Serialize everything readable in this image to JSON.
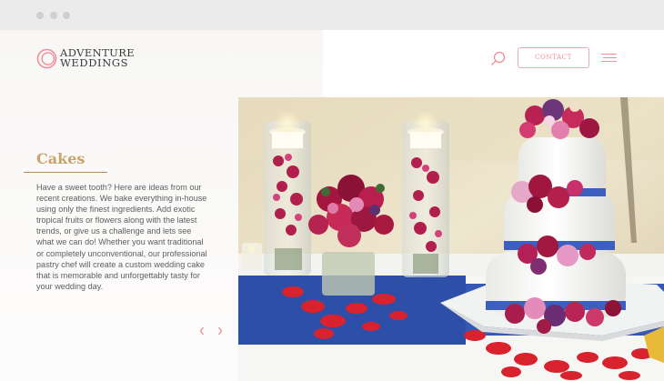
{
  "brand": {
    "name_line1": "ADVENTURE",
    "name_line2": "WEDDINGS",
    "accent_color": "#ef8e99",
    "gold_color": "#c9a46a"
  },
  "header": {
    "search_icon": "search-icon",
    "contact_label": "CONTACT",
    "menu_icon": "hamburger-menu-icon"
  },
  "section": {
    "title": "Cakes",
    "body": "Have a sweet tooth? Here are ideas from our recent creations. We bake everything in-house using only the finest ingredients. Add exotic tropical fruits or flowers along with the latest trends, or give us a challenge and lets see what we can do! Whether you want traditional or completely unconventional, our professional pastry chef will create a custom wedding cake that is memorable and unforgettably tasty for your wedding day."
  },
  "carousel": {
    "prev_icon": "chevron-left-icon",
    "next_icon": "chevron-right-icon"
  },
  "hero_image": {
    "subject": "three-tier white wedding cake with orchids, floating candles and flower arrangement on blue runner"
  }
}
